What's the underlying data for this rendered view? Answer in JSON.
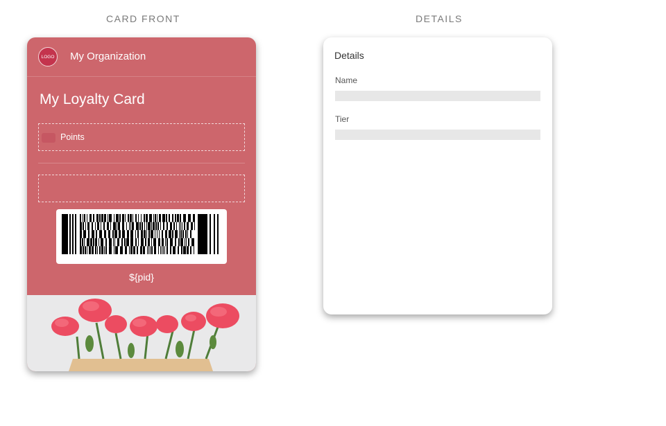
{
  "sections": {
    "front_label": "CARD FRONT",
    "details_label": "DETAILS"
  },
  "card": {
    "logo_text": "LOGO",
    "organization": "My Organization",
    "title": "My Loyalty Card",
    "points_label": "Points",
    "barcode_value": "${pid}",
    "background_color": "#cd666c",
    "image_icon": "carnation-bouquet-image"
  },
  "details": {
    "title": "Details",
    "fields": [
      {
        "label": "Name",
        "value": ""
      },
      {
        "label": "Tier",
        "value": ""
      }
    ]
  }
}
